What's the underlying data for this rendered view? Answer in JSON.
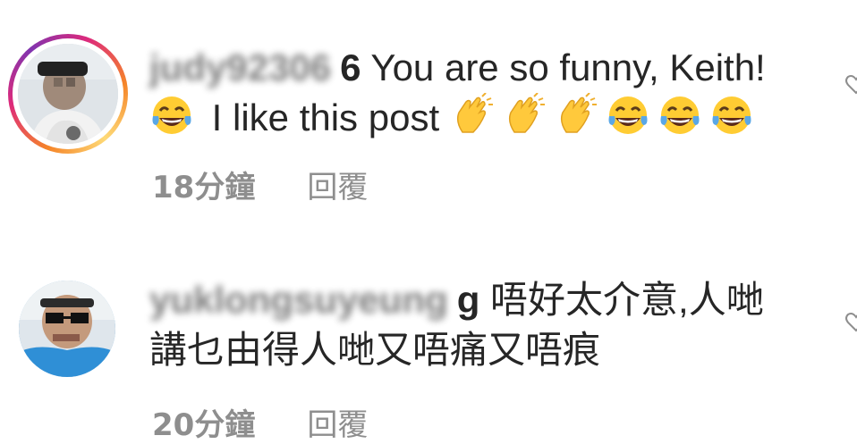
{
  "comments": [
    {
      "username": "judy92306",
      "username_visible_tail": "6",
      "text_line1": " You are so funny, Keith!",
      "text_line2": " I like this post ",
      "emojis_line2_prefix": [
        "face-with-tears-of-joy"
      ],
      "emojis_line2_suffix": [
        "clapping-hands",
        "clapping-hands",
        "clapping-hands",
        "face-with-tears-of-joy",
        "face-with-tears-of-joy",
        "face-with-tears-of-joy"
      ],
      "time": "18分鐘",
      "reply_label": "回覆"
    },
    {
      "username": "yuklongsuyeung",
      "username_visible_tail": "g",
      "text_line1": " 唔好太介意,人哋",
      "text_line2": "講乜由得人哋又唔痛又唔痕",
      "time": "20分鐘",
      "reply_label": "回覆"
    }
  ],
  "colors": {
    "text": "#262626",
    "meta": "#8e8e8e",
    "story_ring_start": "#f58529",
    "story_ring_end": "#dd2a7b"
  }
}
